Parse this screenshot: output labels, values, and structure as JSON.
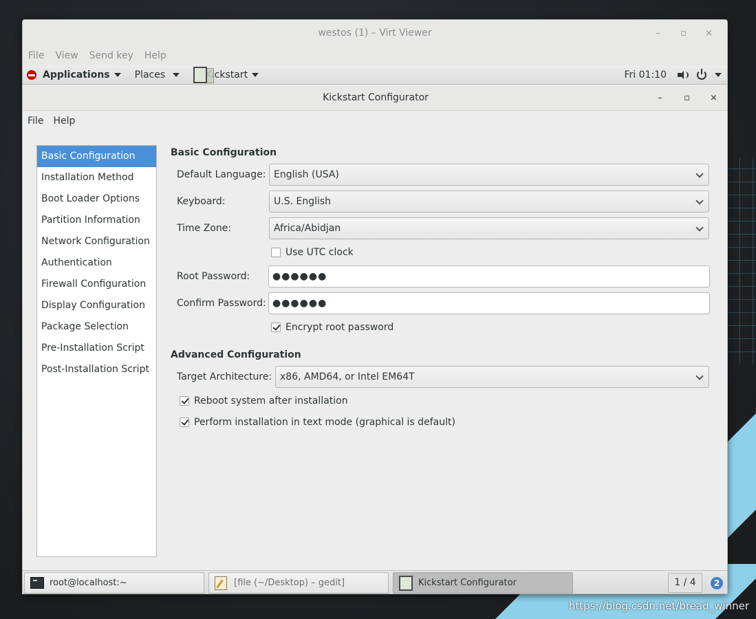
{
  "viewer": {
    "title": "westos (1) – Virt Viewer",
    "controls": {
      "minimize": "–",
      "maximize": "▫",
      "close": "×"
    },
    "menu": [
      "File",
      "View",
      "Send key",
      "Help"
    ]
  },
  "topbar": {
    "applications": "Applications",
    "places": "Places",
    "active_app": "Kickstart",
    "clock": "Fri 01:10"
  },
  "window": {
    "title": "Kickstart Configurator",
    "controls": {
      "minimize": "–",
      "maximize": "▫",
      "close": "×"
    },
    "menu": [
      "File",
      "Help"
    ]
  },
  "sidebar": {
    "items": [
      {
        "label": "Basic Configuration",
        "active": true
      },
      {
        "label": "Installation Method"
      },
      {
        "label": "Boot Loader Options"
      },
      {
        "label": "Partition Information"
      },
      {
        "label": "Network Configuration"
      },
      {
        "label": "Authentication"
      },
      {
        "label": "Firewall Configuration"
      },
      {
        "label": "Display Configuration"
      },
      {
        "label": "Package Selection"
      },
      {
        "label": "Pre-Installation Script"
      },
      {
        "label": "Post-Installation Script"
      }
    ]
  },
  "basic": {
    "title": "Basic Configuration",
    "language_label": "Default Language:",
    "language_value": "English (USA)",
    "keyboard_label": "Keyboard:",
    "keyboard_value": "U.S. English",
    "timezone_label": "Time Zone:",
    "timezone_value": "Africa/Abidjan",
    "utc_label": "Use UTC clock",
    "utc_checked": false,
    "root_pw_label": "Root Password:",
    "root_pw_value": "●●●●●●",
    "confirm_pw_label": "Confirm Password:",
    "confirm_pw_value": "●●●●●●",
    "encrypt_label": "Encrypt root password",
    "encrypt_checked": true
  },
  "advanced": {
    "title": "Advanced Configuration",
    "arch_label": "Target Architecture:",
    "arch_value": "x86, AMD64, or Intel EM64T",
    "reboot_label": "Reboot system after installation",
    "reboot_checked": true,
    "textmode_label": "Perform installation in text mode (graphical is default)",
    "textmode_checked": true
  },
  "taskbar": {
    "tasks": [
      {
        "label": "root@localhost:~"
      },
      {
        "label": "[file (~/Desktop) – gedit]"
      },
      {
        "label": "Kickstart Configurator"
      }
    ],
    "workspace": "1 / 4",
    "notifications": "2"
  },
  "watermark": "https://blog.csdn.net/bread_winner",
  "colors": {
    "selection": "#4a90d9",
    "desktop_accent": "#8ed0ea"
  }
}
